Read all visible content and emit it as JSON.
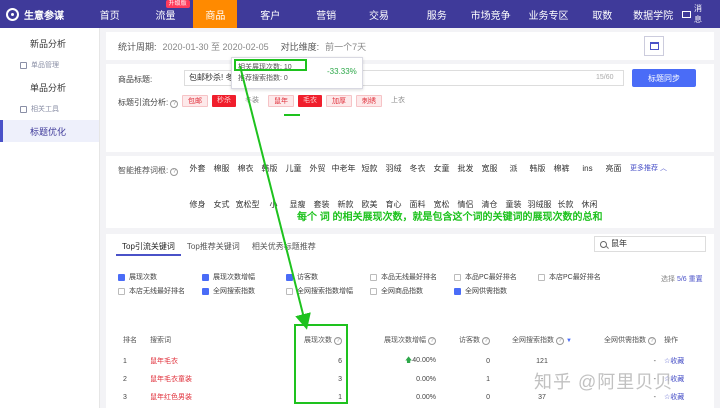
{
  "topnav": {
    "brand": "生意参谋",
    "items": [
      "首页",
      "流量",
      "商品",
      "客户",
      "营销",
      "交易",
      "服务",
      "市场竞争",
      "业务专区",
      "取数",
      "数据学院"
    ],
    "badge": "升级版",
    "message": "消息",
    "accent": "#3f3a9a",
    "active_color": "#ff8a00"
  },
  "sidebar": {
    "item_product_analysis": "新品分析",
    "group_product_manage": "单品管理",
    "item_single_analysis": "单品分析",
    "group_tools": "相关工具",
    "item_title_opt": "标题优化"
  },
  "period": {
    "label": "统计周期:",
    "date_range": "2020-01-30 至 2020-02-05",
    "compare_label": "对比维度:",
    "compare_value": "前一个7天"
  },
  "title_section": {
    "title_label": "商品标题:",
    "title_value": "包邮秒杀! 冬",
    "counter": "15/60",
    "sync_button": "标题同步",
    "traffic_label": "标题引流分析:",
    "chips": [
      "包邮",
      "秒杀",
      "冬装",
      "鼠年",
      "毛衣",
      "加厚",
      "刺绣",
      "上衣"
    ]
  },
  "tooltip": {
    "line1_label": "相关展现次数:",
    "line1_value": "10",
    "line1_pct": "-33.33%",
    "line2_label": "推荐搜索指数:",
    "line2_value": "0"
  },
  "recommend": {
    "label": "智能推荐词根:",
    "row1": [
      "外套",
      "棉服",
      "棉衣",
      "韩版",
      "儿童",
      "外贸",
      "中老年",
      "短款",
      "羽绒",
      "冬衣",
      "女童",
      "批发",
      "宽服",
      "派",
      "韩版",
      "棉裤",
      "ins",
      "亮面"
    ],
    "more": "更多推荐",
    "row2": [
      "修身",
      "女式",
      "宽松型",
      "小",
      "显瘦",
      "套装",
      "新款",
      "欧美",
      "育心",
      "面料",
      "宽松",
      "情侣",
      "清仓",
      "童装",
      "羽绒服",
      "长款",
      "休闲"
    ]
  },
  "annotation": "每个 词 的相关展现次数，就是包含这个词的关键词的展现次数的总和",
  "table": {
    "tabs": [
      "Top引流关键词",
      "Top推荐关键词",
      "相关优秀标题推荐"
    ],
    "search_value": "鼠年",
    "checkbox_row1": [
      {
        "label": "展现次数",
        "on": true
      },
      {
        "label": "展现次数增幅",
        "on": true
      },
      {
        "label": "访客数",
        "on": true
      },
      {
        "label": "本品无线最好排名",
        "on": false
      },
      {
        "label": "本品PC最好排名",
        "on": false
      },
      {
        "label": "本店PC最好排名",
        "on": false
      }
    ],
    "checkbox_row2": [
      {
        "label": "本店无线最好排名",
        "on": false
      },
      {
        "label": "全网搜索指数",
        "on": true
      },
      {
        "label": "全网搜索指数增幅",
        "on": false
      },
      {
        "label": "全网商品指数",
        "on": false
      },
      {
        "label": "全网供需指数",
        "on": true
      }
    ],
    "select_label": "选择",
    "select_count": "5/6",
    "reset": "重置",
    "headers": [
      "排名",
      "搜索词",
      "展现次数",
      "展现次数增幅",
      "访客数",
      "全网搜索指数",
      "全网供需指数",
      "操作"
    ],
    "rows": [
      {
        "rank": "1",
        "kw": "鼠年",
        "rest": "毛衣",
        "imp": "6",
        "growth": "40.00%",
        "up": true,
        "visit": "0",
        "search": "121",
        "supply": "-",
        "op": "收藏"
      },
      {
        "rank": "2",
        "kw": "鼠年",
        "rest": "毛衣童装",
        "imp": "3",
        "growth": "0.00%",
        "up": false,
        "visit": "1",
        "search": "-",
        "supply": "-",
        "op": "收藏"
      },
      {
        "rank": "3",
        "kw": "鼠年",
        "rest": "红色男装",
        "imp": "1",
        "growth": "0.00%",
        "up": false,
        "visit": "0",
        "search": "37",
        "supply": "-",
        "op": "收藏"
      }
    ]
  },
  "watermark": "知乎 @阿里贝贝"
}
